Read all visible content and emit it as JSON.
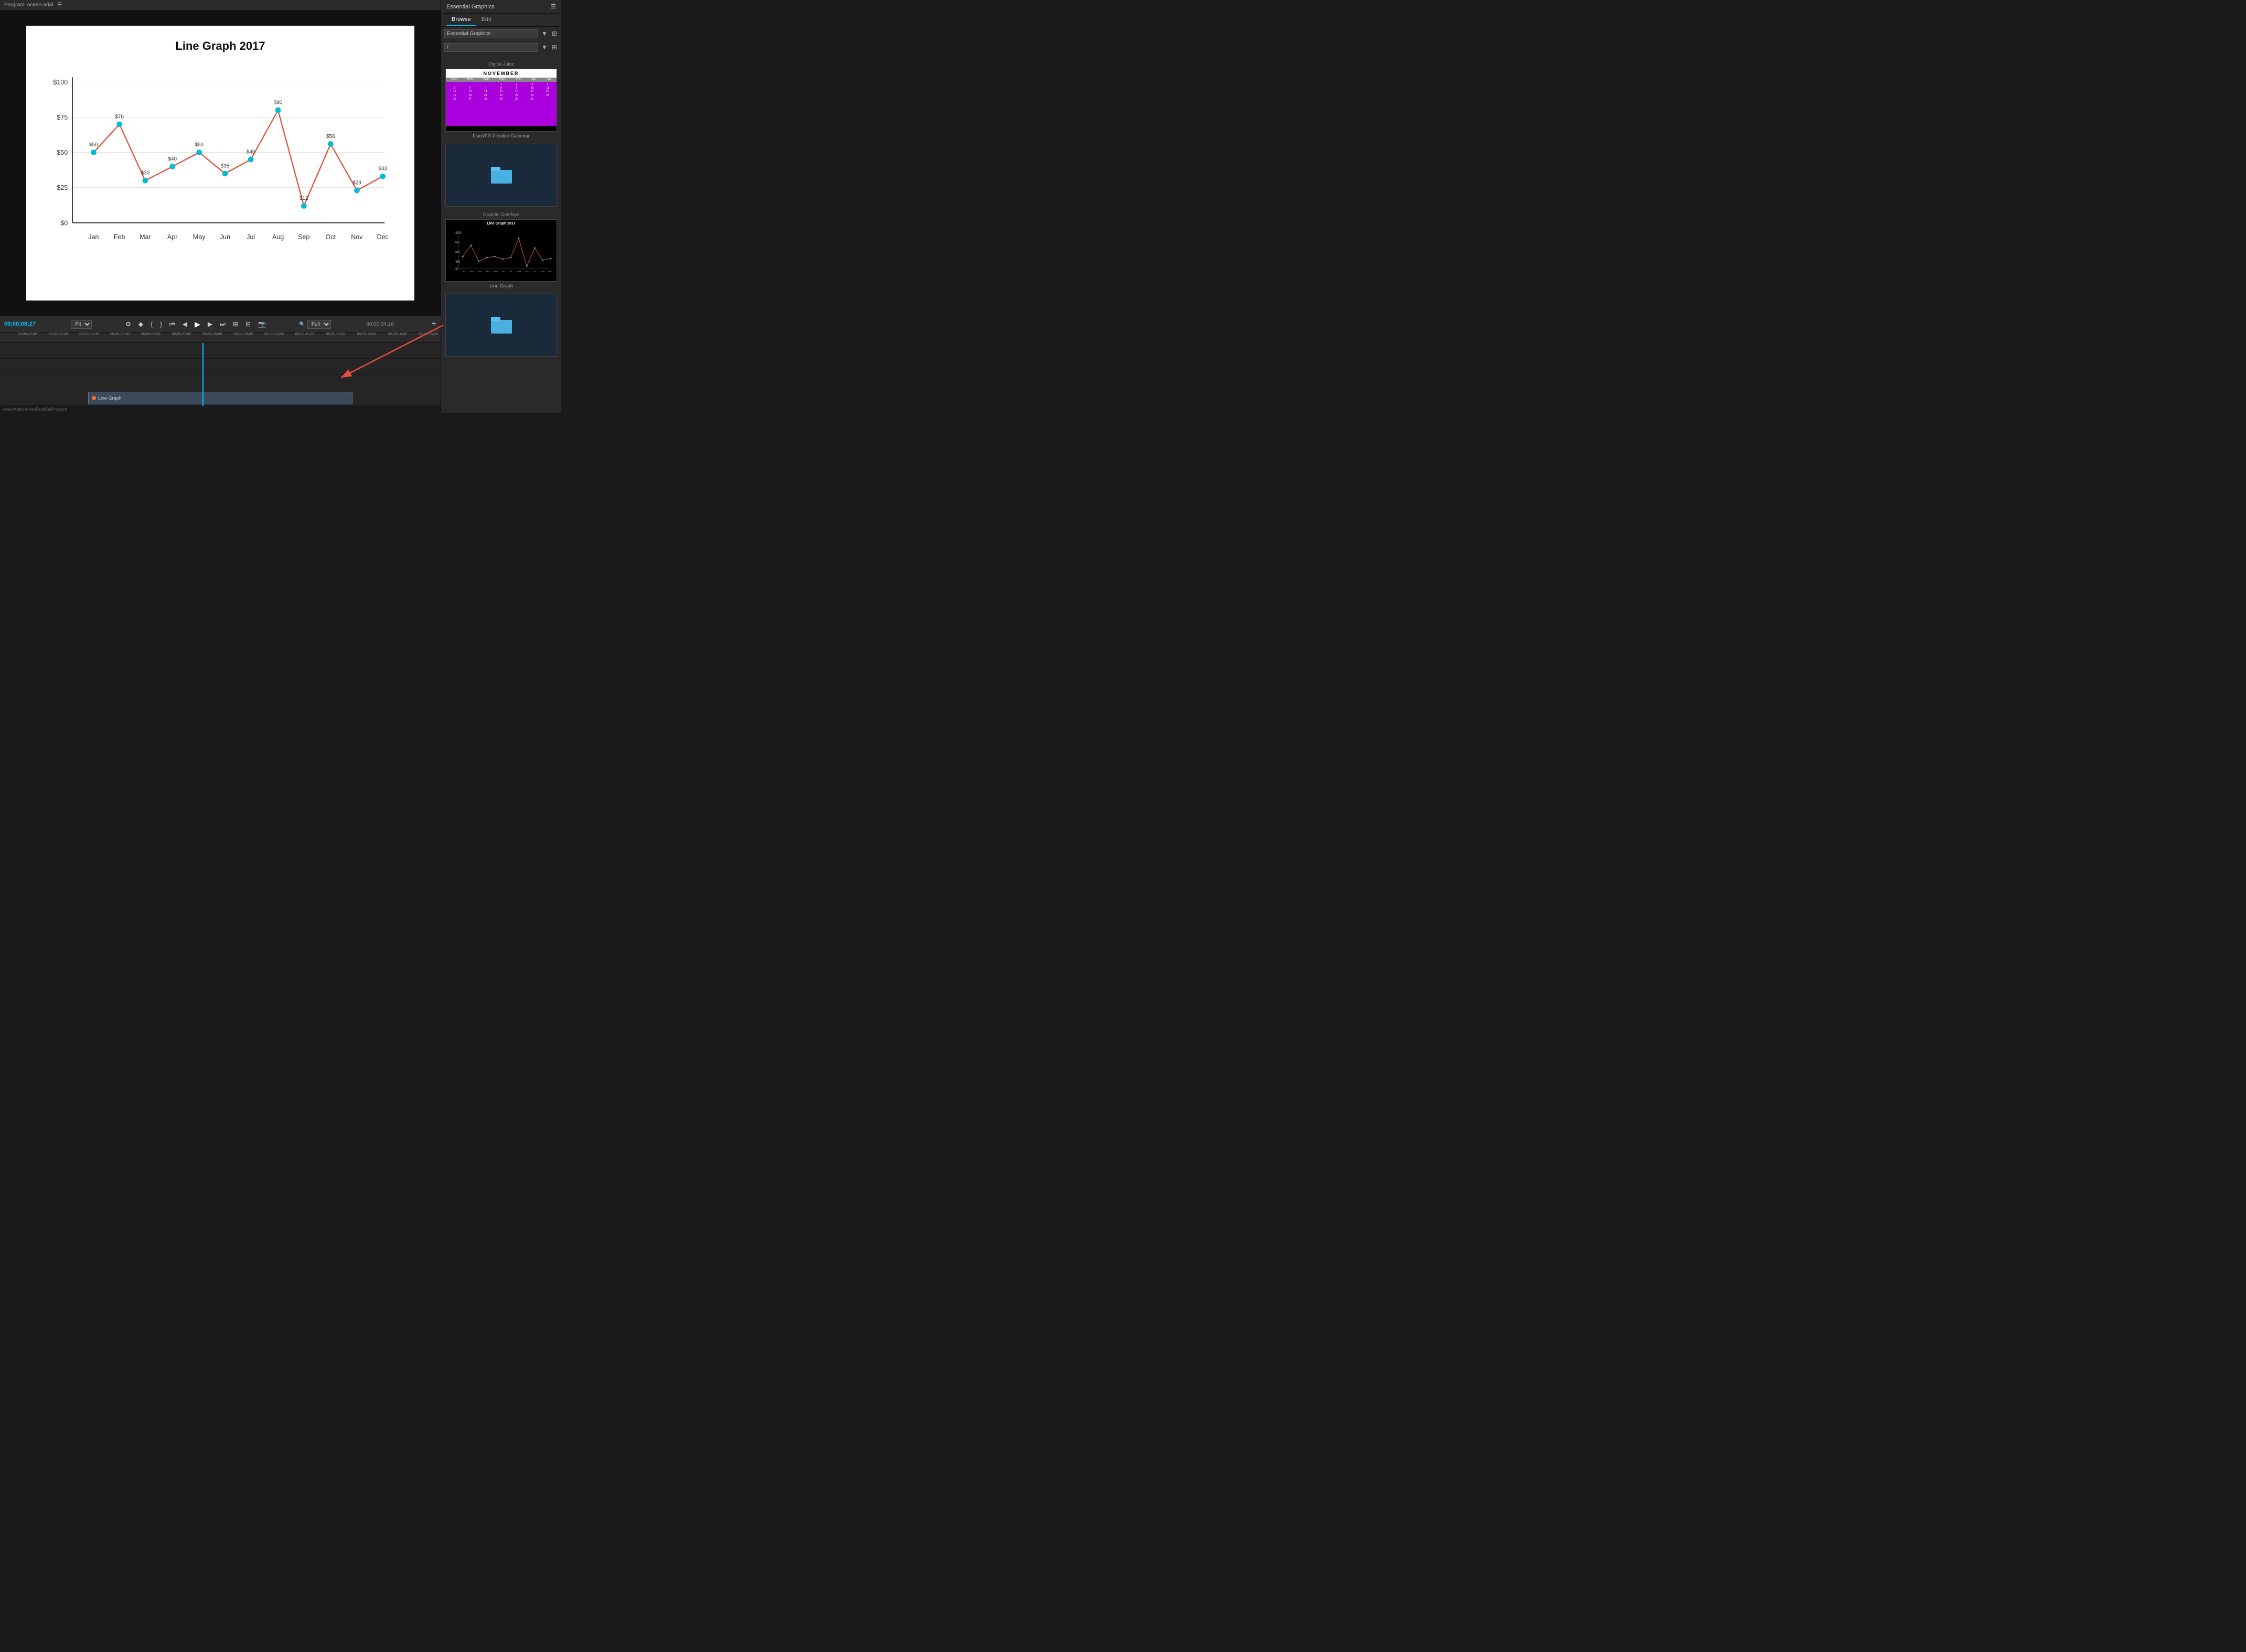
{
  "app": {
    "title": "Program: ocean-arial",
    "menu_icon": "☰"
  },
  "program_monitor": {
    "time_current": "00;00;08;27",
    "time_total": "00;00;04;16",
    "fit_label": "Fit",
    "full_label": "Full"
  },
  "chart": {
    "title": "Line Graph 2017",
    "y_labels": [
      "$100",
      "$75",
      "$50",
      "$25",
      "$0"
    ],
    "x_labels": [
      "Jan",
      "Feb",
      "Mar",
      "Apr",
      "May",
      "Jun",
      "Jul",
      "Aug",
      "Sep",
      "Oct",
      "Nov",
      "Dec"
    ],
    "data_points": [
      {
        "month": "Jan",
        "value": 50,
        "label": "$50"
      },
      {
        "month": "Feb",
        "value": 70,
        "label": "$70"
      },
      {
        "month": "Mar",
        "value": 30,
        "label": "$30"
      },
      {
        "month": "Apr",
        "value": 40,
        "label": "$40"
      },
      {
        "month": "May",
        "value": 50,
        "label": "$50"
      },
      {
        "month": "Jun",
        "value": 35,
        "label": "$35"
      },
      {
        "month": "Jul",
        "value": 45,
        "label": "$45"
      },
      {
        "month": "Aug",
        "value": 80,
        "label": "$80"
      },
      {
        "month": "Sep",
        "value": 12,
        "label": "$12"
      },
      {
        "month": "Oct",
        "value": 56,
        "label": "$56"
      },
      {
        "month": "Nov",
        "value": 23,
        "label": "$23"
      },
      {
        "month": "Dec",
        "value": 33,
        "label": "$33"
      }
    ],
    "y_max": 100
  },
  "timeline": {
    "time_markers": [
      "00;00;02;00",
      "00;00;03;00",
      "00;00;04;00",
      "00;00;05;00",
      "00;00;06;00",
      "00;00;07;00",
      "00;00;08;00",
      "00;00;09;00",
      "00;00;10;00",
      "00;00;11;00",
      "00;00;12;00",
      "00;00;13;00",
      "00;00;14;00",
      "00;00;15;00",
      "00;00;16;00"
    ],
    "clip_label": "Line Graph",
    "playhead_position_pct": 40
  },
  "controls": {
    "buttons": [
      "⟨⟨",
      "◀",
      "{",
      "}",
      "◀◀",
      "◀",
      "▶",
      "▶▶",
      "▶▶⟩",
      "⟩"
    ]
  },
  "essential_graphics": {
    "panel_title": "Essential Graphics",
    "tabs": [
      "Browse",
      "Edit"
    ],
    "active_tab": "Browse",
    "dropdown_1": "Essential Graphics",
    "dropdown_2": "/",
    "sections": [
      {
        "label": "Digital-Juice",
        "items": [
          {
            "type": "calendar",
            "name": "FluoVFX-Flexible-Calendar",
            "month": "NOVEMBER",
            "days": [
              "SUN",
              "MON",
              "TUE",
              "WED",
              "THU",
              "FRI",
              "SAT"
            ],
            "rows": [
              [
                "",
                "",
                "",
                "1",
                "2",
                "3",
                "4"
              ],
              [
                "5",
                "6",
                "7",
                "8",
                "9",
                "10",
                "11"
              ],
              [
                "12",
                "13",
                "14",
                "15",
                "16",
                "17",
                "18"
              ],
              [
                "19",
                "20",
                "21",
                "22",
                "23",
                "24",
                "25"
              ],
              [
                "26",
                "27",
                "28",
                "29",
                "30",
                "31",
                ""
              ]
            ]
          },
          {
            "type": "folder",
            "name": ""
          }
        ]
      },
      {
        "label": "Graphic Overlays",
        "items": [
          {
            "type": "line-graph",
            "name": "Line Graph"
          },
          {
            "type": "folder",
            "name": ""
          }
        ]
      }
    ]
  },
  "status_bar": {
    "text": "www.MotionArrayFinalCutPro.com"
  }
}
